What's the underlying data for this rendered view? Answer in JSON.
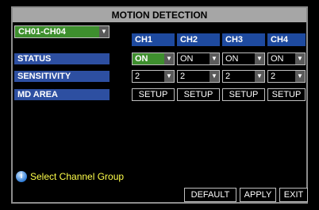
{
  "dialog": {
    "title": "MOTION DETECTION"
  },
  "channel_group": {
    "selected": "CH01-CH04"
  },
  "channels": [
    "CH1",
    "CH2",
    "CH3",
    "CH4"
  ],
  "rows": {
    "status": {
      "label": "STATUS",
      "values": [
        "ON",
        "ON",
        "ON",
        "ON"
      ]
    },
    "sensitivity": {
      "label": "SENSITIVITY",
      "values": [
        "2",
        "2",
        "2",
        "2"
      ]
    },
    "md_area": {
      "label": "MD AREA",
      "button_label": "SETUP"
    }
  },
  "hint": {
    "text": "Select Channel Group",
    "icon": "info-icon"
  },
  "footer": {
    "default_label": "DEFAULT",
    "apply_label": "APPLY",
    "exit_label": "EXIT"
  },
  "colors": {
    "selected": "#3e8f2e",
    "label_bg": "#2d4fa1",
    "header_bg": "#1e4a9f",
    "hint_text": "#ffff4a",
    "titlebar": "#a6a6a6"
  }
}
